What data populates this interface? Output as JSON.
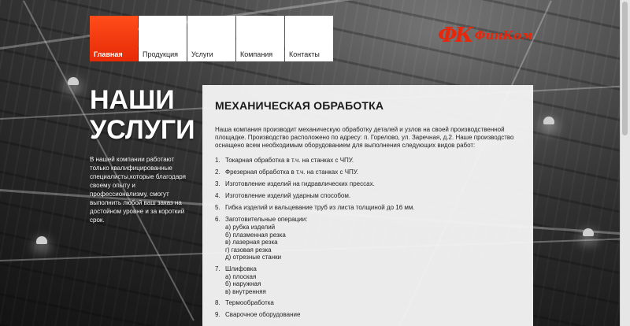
{
  "nav": {
    "items": [
      {
        "label": "Главная",
        "active": true
      },
      {
        "label": "Продукция",
        "active": false
      },
      {
        "label": "Услуги",
        "active": false
      },
      {
        "label": "Компания",
        "active": false
      },
      {
        "label": "Контакты",
        "active": false
      }
    ]
  },
  "logo": {
    "mark": "ФК",
    "name": "ФинКом",
    "color": "#e8260a"
  },
  "hero": {
    "title_line1": "НАШИ",
    "title_line2": "УСЛУГИ",
    "text": "В нашей компании работают только квалифицированные специалисты,которые благодаря своему опыту и профессионализму, смогут выполнить любой ваш заказ на достойном уровне и за короткий срок."
  },
  "content": {
    "title": "МЕХАНИЧЕСКАЯ ОБРАБОТКА",
    "intro": "Наша компания производит механическую обработку деталей и узлов на своей производственной площадке. Производство расположено по адресу: п. Горелово, ул. Заречная, д.2. Наше производство оснащено всем необходимым оборудованием для выполнения следующих видов работ:",
    "services": [
      {
        "num": "1.",
        "text": "Токарная обработка в т.ч. на станках с ЧПУ.",
        "sub": []
      },
      {
        "num": "2.",
        "text": "Фрезерная обработка в т.ч. на станках с ЧПУ.",
        "sub": []
      },
      {
        "num": "3.",
        "text": "Изготовление изделий на гидравлических прессах.",
        "sub": []
      },
      {
        "num": "4.",
        "text": "Изготовление изделий ударным способом.",
        "sub": []
      },
      {
        "num": "5.",
        "text": "Гибка изделий и вальцевание труб из листа толщиной до 16 мм.",
        "sub": []
      },
      {
        "num": "6.",
        "text": "Заготовительные операции:",
        "sub": [
          "а) рубка изделий",
          "б) плазменная резка",
          "в) лазерная резка",
          "г) газовая резка",
          "д) отрезные станки"
        ]
      },
      {
        "num": "7.",
        "text": "Шлифовка",
        "sub": [
          "а) плоская",
          "б) наружная",
          "в) внутренняя"
        ]
      },
      {
        "num": "8.",
        "text": "Термообработка",
        "sub": []
      },
      {
        "num": "9.",
        "text": "Сварочное оборудование",
        "sub": []
      }
    ]
  },
  "colors": {
    "accent": "#e62a06",
    "panel": "#f4f4f4"
  }
}
